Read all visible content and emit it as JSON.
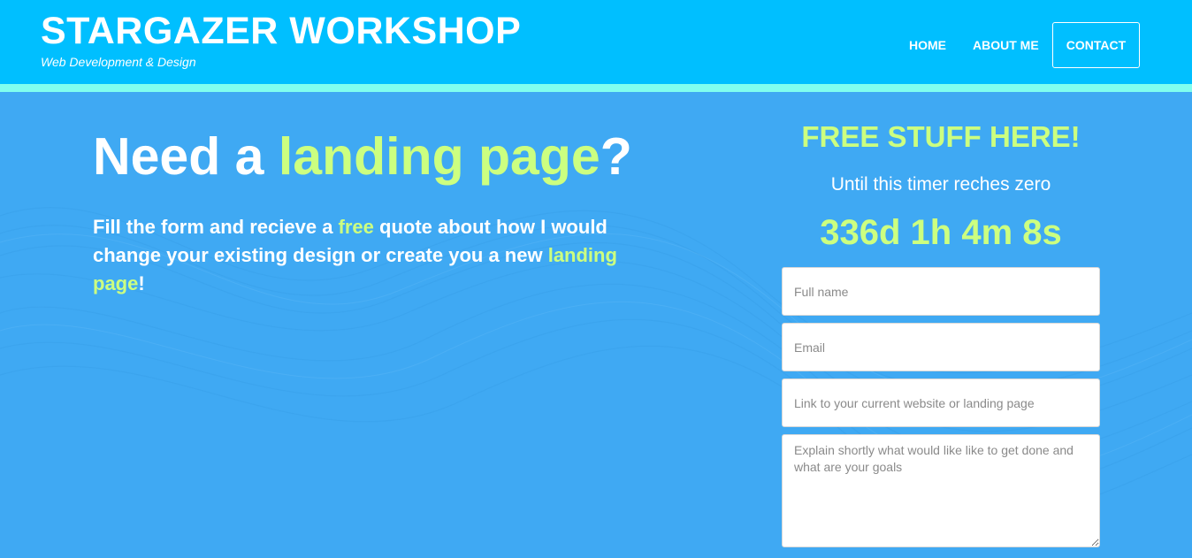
{
  "header": {
    "title": "STARGAZER WORKSHOP",
    "subtitle": "Web Development & Design",
    "nav": {
      "home": "HOME",
      "about": "ABOUT ME",
      "contact": "CONTACT"
    }
  },
  "hero": {
    "headline": {
      "part1": "Need a ",
      "highlight": "landing page",
      "part2": "?"
    },
    "intro": {
      "part1": "Fill the form and recieve a ",
      "free": "free",
      "part2": " quote about how I would change your existing design or create you a new ",
      "landing": "landing page",
      "part3": "!"
    }
  },
  "offer": {
    "title": "FREE STUFF HERE!",
    "timer_note": "Until this timer reches zero",
    "timer": "336d 1h 4m 8s"
  },
  "form": {
    "name_placeholder": "Full name",
    "email_placeholder": "Email",
    "link_placeholder": "Link to your current website or landing page",
    "message_placeholder": "Explain shortly what would like like to get done and what are your goals"
  },
  "colors": {
    "header_bg": "#00bfff",
    "accent_bar": "#80ffef",
    "page_bg": "#3fa9f3",
    "highlight": "#ccff80"
  }
}
